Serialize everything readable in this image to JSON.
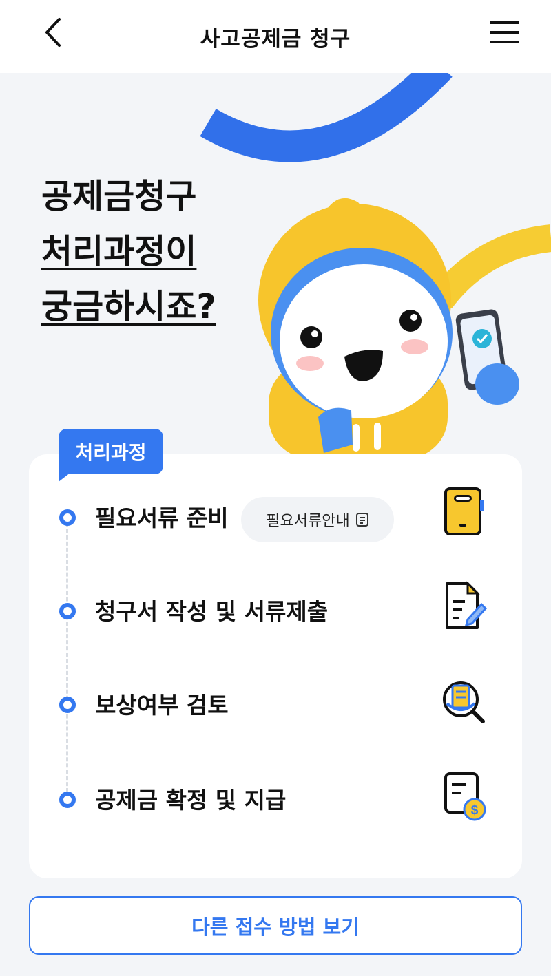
{
  "header": {
    "title": "사고공제금 청구",
    "back_icon": "chevron-left-icon",
    "menu_icon": "hamburger-menu-icon"
  },
  "hero": {
    "line1": "공제금청구",
    "line2": "처리과정이",
    "line3": "궁금하시죠?"
  },
  "process": {
    "tag_label": "처리과정",
    "steps": [
      {
        "label": "필요서류 준비",
        "icon": "phone-document-icon"
      },
      {
        "label": "청구서 작성 및 서류제출",
        "icon": "document-edit-icon"
      },
      {
        "label": "보상여부 검토",
        "icon": "magnifier-review-icon"
      },
      {
        "label": "공제금 확정 및 지급",
        "icon": "document-payment-icon"
      }
    ],
    "guide_button_label": "필요서류안내"
  },
  "footer": {
    "other_methods_label": "다른 접수 방법 보기"
  },
  "colors": {
    "accent": "#3478f0",
    "yellow": "#f7c72e",
    "background": "#f3f5f8"
  }
}
